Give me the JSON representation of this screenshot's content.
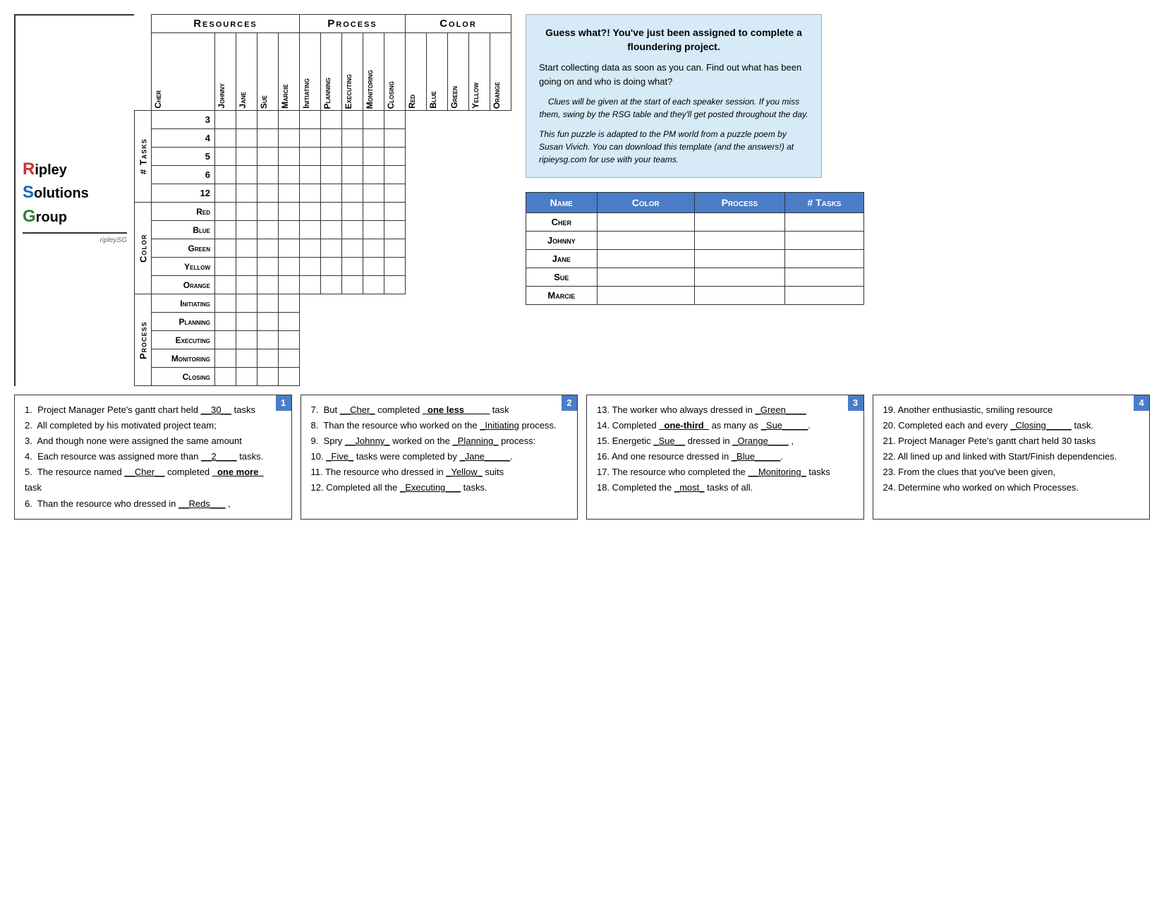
{
  "logo": {
    "line1": "ipley",
    "line2": "olutions",
    "line3": "roup",
    "r": "R",
    "s": "S",
    "g": "G"
  },
  "headers": {
    "resources": "Resources",
    "process": "Process",
    "color": "Color"
  },
  "columns": {
    "resources": [
      "Cher",
      "Johnny",
      "Jane",
      "Sue",
      "Marcie"
    ],
    "process": [
      "Initiating",
      "Planning",
      "Executing",
      "Monitoring",
      "Closing"
    ],
    "color": [
      "Red",
      "Blue",
      "Green",
      "Yellow",
      "Orange"
    ]
  },
  "row_sections": {
    "tasks": {
      "label": "# Tasks",
      "rows": [
        "3",
        "4",
        "5",
        "6",
        "12"
      ]
    },
    "color": {
      "label": "Color",
      "rows": [
        "Red",
        "Blue",
        "Green",
        "Yellow",
        "Orange"
      ]
    },
    "process": {
      "label": "Process",
      "rows": [
        "Initiating",
        "Planning",
        "Executing",
        "Monitoring",
        "Closing"
      ]
    }
  },
  "info_box": {
    "title": "Guess what?! You've just been assigned to complete a floundering project.",
    "body": "Start collecting data as soon as you can.  Find out what has been going on and who is doing what?",
    "italic1": "Clues will be given at the start of each speaker session.  If you miss them, swing by the RSG table and they'll get posted throughout the day.",
    "italic2": "This fun puzzle is adapted to the PM world from a puzzle poem by Susan Vivich.  You can download this template (and the answers!) at ripieysg.com for use with your teams."
  },
  "summary_table": {
    "headers": [
      "Name",
      "Color",
      "Process",
      "# Tasks"
    ],
    "rows": [
      {
        "name": "Cher"
      },
      {
        "name": "Johnny"
      },
      {
        "name": "Jane"
      },
      {
        "name": "Sue"
      },
      {
        "name": "Marcie"
      }
    ]
  },
  "clues": {
    "box1": {
      "badge": "1",
      "lines": [
        "1.  Project Manager Pete's gantt chart held <u>__30__</u> tasks",
        "2.  All completed by his motivated project team;",
        "3.  And though none were assigned the same amount",
        "4.  Each resource was assigned more than <u>__2____</u> tasks.",
        "5.  The resource named <u>__Cher__</u> completed <b><u>_one more_</u></b> task",
        "6.  Than the resource who dressed in <u>__Reds___</u> ,"
      ]
    },
    "box2": {
      "badge": "2",
      "lines": [
        "7.  But <u>__Cher_</u> completed <b><u>_one less_____</u></b> task",
        "8.  Than the resource who worked on the <u>_Initiating</u> process.",
        "9.  Spry <u>__Johnny_</u> worked on the <u>_Planning_</u> process:",
        "10. <u>_Five_</u> tasks were completed by <u>_Jane_____</u>.",
        "11. The resource who dressed in <u>_Yellow_</u> suits",
        "12. Completed all the <u>_Executing___</u> tasks."
      ]
    },
    "box3": {
      "badge": "3",
      "lines": [
        "13. The worker who always dressed in <u>_Green____</u>",
        "14. Completed <b><u>_one-third_</u></b> as many as <u>_Sue_____</u>.",
        "15. Energetic <u>_Sue__</u> dressed in <u>_Orange____</u> ,",
        "16. And one resource dressed in <u>_Blue_____</u>.",
        "17. The resource who completed the <u>__Monitoring_</u> tasks",
        "18. Completed the <u>_most_</u> tasks of all."
      ]
    },
    "box4": {
      "badge": "4",
      "lines": [
        "19. Another enthusiastic, smiling resource",
        "20. Completed each and every <u>_Closing_____</u> task.",
        "21. Project Manager Pete's gantt chart held 30 tasks",
        "22. All lined up and linked with Start/Finish dependencies.",
        "23. From the clues that you've been given,",
        "24. Determine who worked on which Processes."
      ]
    }
  }
}
